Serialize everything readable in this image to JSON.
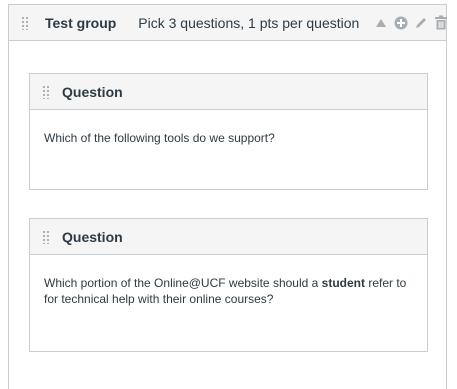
{
  "group": {
    "title": "Test group",
    "description": "Pick 3 questions, 1 pts per question",
    "icons": [
      "move-up-icon",
      "add-icon",
      "edit-icon",
      "delete-icon"
    ]
  },
  "questions": [
    {
      "title": "Question",
      "text": "Which of the following tools do we support?"
    },
    {
      "title": "Question",
      "text_before": "Which portion of the Online@UCF website should a ",
      "text_bold": "student",
      "text_after": " refer to for technical help with their online courses?"
    }
  ],
  "colors": {
    "border": "#c7cdd1",
    "header_bg": "#f5f5f5",
    "text": "#2d3b45",
    "icon": "#a8adb2"
  }
}
